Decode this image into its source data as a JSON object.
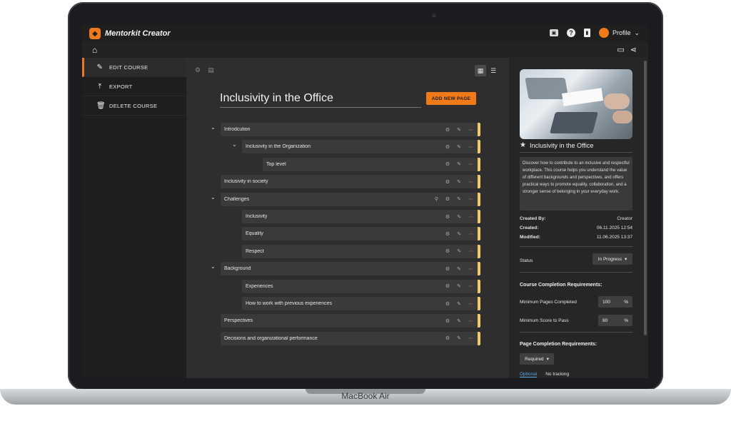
{
  "device": {
    "label": "MacBook Air"
  },
  "app": {
    "brand": "Mentorkit Creator",
    "profile_label": "Profile"
  },
  "topbar": {
    "icons": [
      "folder-image-icon",
      "help-icon",
      "book-icon"
    ]
  },
  "sidebar": {
    "items": [
      {
        "label": "EDIT COURSE",
        "icon": "pencil-icon",
        "active": true
      },
      {
        "label": "EXPORT",
        "icon": "upload-icon",
        "active": false
      },
      {
        "label": "DELETE COURSE",
        "icon": "trash-icon",
        "active": false
      }
    ]
  },
  "course": {
    "title": "Inclusivity in the Office",
    "add_page_label": "ADD NEW PAGE"
  },
  "tree": [
    {
      "label": "Introdcution",
      "level": 0,
      "caret": true
    },
    {
      "label": "Inclusivity in the Organization",
      "level": 1,
      "caret": true
    },
    {
      "label": "Top level",
      "level": 2,
      "caret": false
    },
    {
      "label": "Inclusivity in society",
      "level": 0,
      "caret": false
    },
    {
      "label": "Challenges",
      "level": 0,
      "caret": true,
      "pin": true
    },
    {
      "label": "Inclusivity",
      "level": 1,
      "caret": false
    },
    {
      "label": "Equality",
      "level": 1,
      "caret": false
    },
    {
      "label": "Respect",
      "level": 1,
      "caret": false
    },
    {
      "label": "Background",
      "level": 0,
      "caret": true
    },
    {
      "label": "Experiences",
      "level": 1,
      "caret": false
    },
    {
      "label": "How to work with previous experiences",
      "level": 1,
      "caret": false
    },
    {
      "label": "Perspectives",
      "level": 0,
      "caret": false
    },
    {
      "label": "Decisions and organizational performance",
      "level": 0,
      "caret": false
    }
  ],
  "panel": {
    "title": "Inclusivity in the Office",
    "description": "Discover how to contribute to an inclusive and respectful workplace. This course helps you understand the value of different backgrounds and perspectives, and offers practical ways to promote equality, collaboration, and a stronger sense of belonging in your everyday work.",
    "created_by_label": "Created By:",
    "created_by": "Creator",
    "created_label": "Created:",
    "created": "06.11.2025 12:54",
    "modified_label": "Modified:",
    "modified": "11.06.2025 13:37",
    "status_label": "Status",
    "status_value": "In Progress",
    "course_req_heading": "Course Completion Requirements:",
    "min_pages_label": "Minimum Pages Completed",
    "min_pages_value": "100",
    "min_score_label": "Minimum Score to Pass",
    "min_score_value": "80",
    "percent": "%",
    "page_req_heading": "Page Completion Requirements:",
    "page_req_value": "Required",
    "tab_optional": "Optional",
    "tab_no_tracking": "No tracking"
  }
}
